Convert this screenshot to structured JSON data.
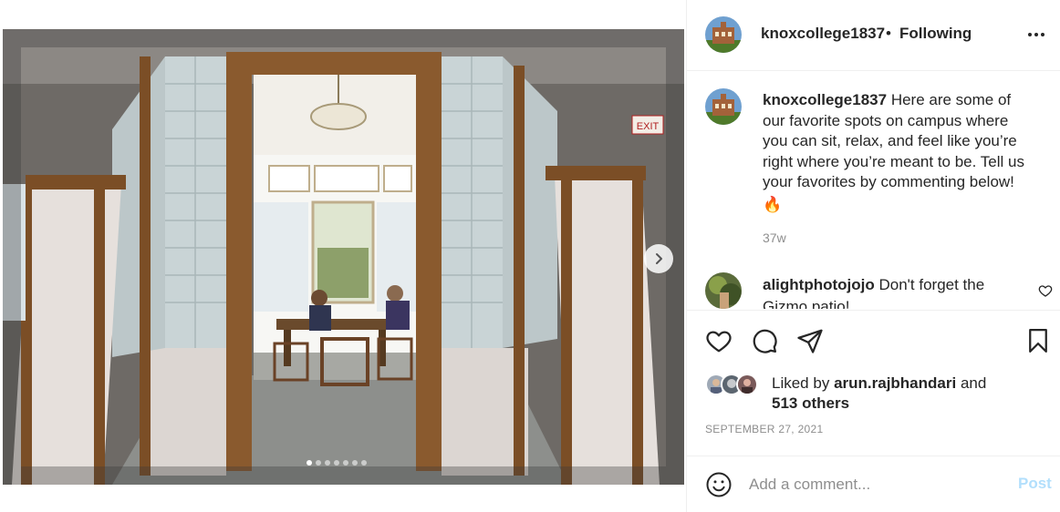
{
  "post": {
    "author": "knoxcollege1837",
    "separator": "•",
    "follow_status": "Following",
    "caption_text": "Here are some of our favorite spots on campus where you can sit, relax, and feel like you’re right where you’re meant to be. Tell us your favorites by commenting below!",
    "caption_emoji": "🔥",
    "time_ago": "37w",
    "date": "SEPTEMBER 27, 2021"
  },
  "comment": {
    "author": "alightphotojojo",
    "text": "Don't forget the Gizmo patio!"
  },
  "likes": {
    "prefix": "Liked by",
    "user": "arun.rajbhandari",
    "and": "and",
    "others": "513 others"
  },
  "carousel": {
    "total_slides": 7,
    "active_index": 0
  },
  "comment_box": {
    "placeholder": "Add a comment...",
    "post_label": "Post"
  },
  "icons": {
    "like": "heart-icon",
    "comment": "comment-bubble-icon",
    "share": "paper-plane-icon",
    "save": "bookmark-icon",
    "more": "more-options-icon",
    "next": "chevron-right-icon",
    "emoji": "emoji-smile-icon"
  },
  "colors": {
    "text": "#262626",
    "muted": "#8e8e8e",
    "post_disabled": "#b2dffc",
    "divider": "#efefef"
  }
}
